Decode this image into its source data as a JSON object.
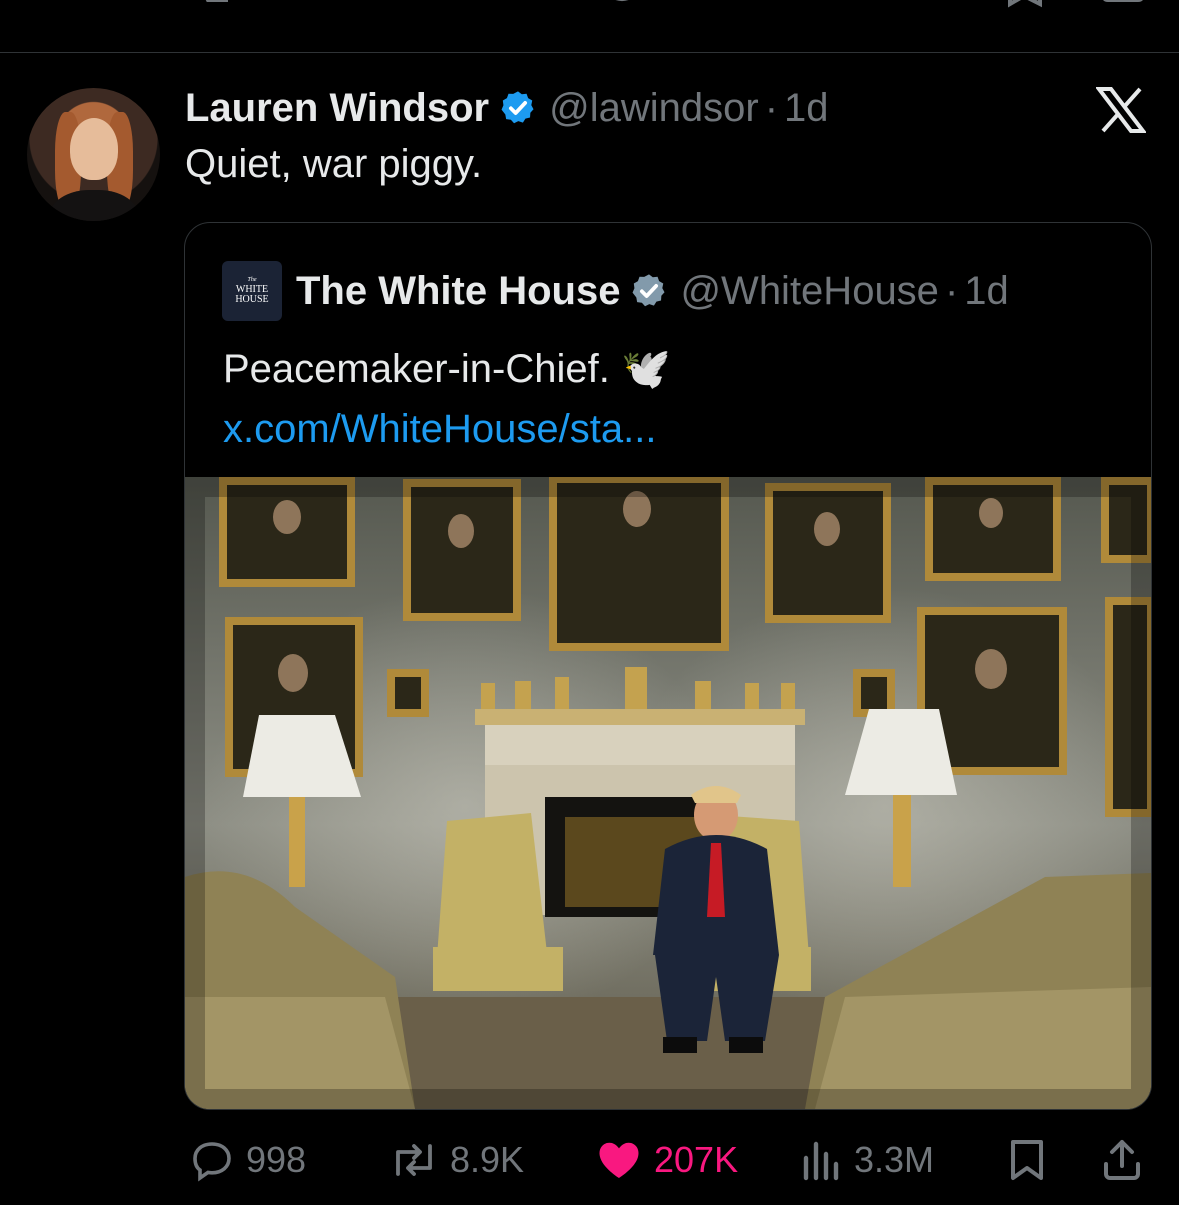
{
  "tweet": {
    "author_name": "Lauren Windsor",
    "author_handle": "@lawindsor",
    "time": "1d",
    "text": "Quiet, war piggy."
  },
  "quote": {
    "author_name": "The White House",
    "author_handle": "@WhiteHouse",
    "time": "1d",
    "text": "Peacemaker-in-Chief.",
    "emoji": "🕊️",
    "link_text": "x.com/WhiteHouse/sta...",
    "logo_lines": [
      "The",
      "WHITE",
      "HOUSE"
    ]
  },
  "actions": {
    "replies": "998",
    "reposts": "8.9K",
    "likes": "207K",
    "views": "3.3M"
  },
  "colors": {
    "background": "#000000",
    "text_primary": "#e7e9ea",
    "text_secondary": "#71767b",
    "link": "#1d9bf0",
    "verified": "#1d9bf0",
    "liked": "#f91880",
    "border": "#2f3336"
  },
  "icons": [
    "x-logo-icon",
    "verified-badge-icon",
    "reply-icon",
    "repost-icon",
    "like-icon",
    "views-icon",
    "bookmark-icon",
    "share-icon"
  ]
}
